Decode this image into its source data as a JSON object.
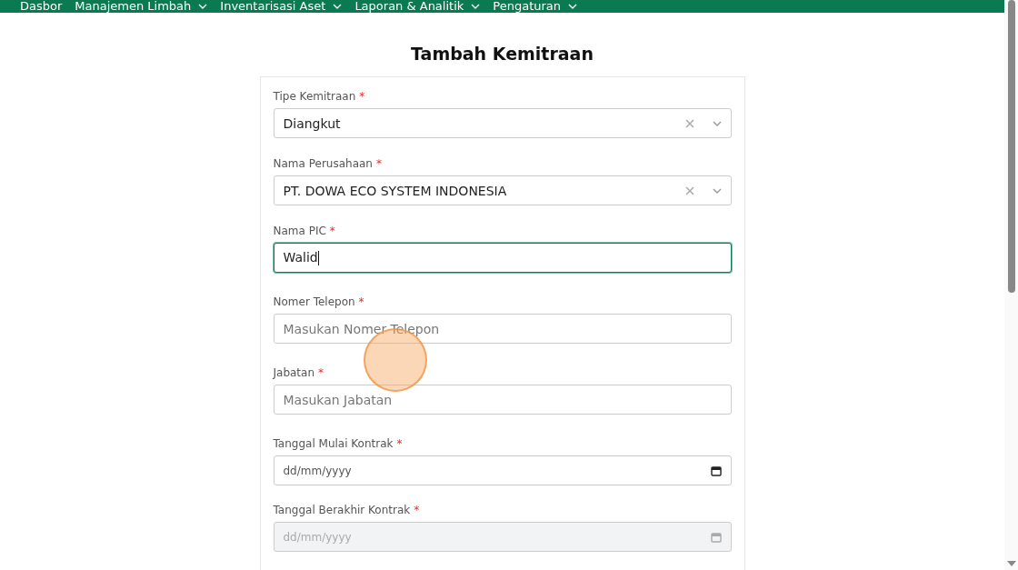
{
  "nav": {
    "items": [
      {
        "label": "Dasbor",
        "dropdown": false
      },
      {
        "label": "Manajemen Limbah",
        "dropdown": true
      },
      {
        "label": "Inventarisasi Aset",
        "dropdown": true
      },
      {
        "label": "Laporan & Analitik",
        "dropdown": true
      },
      {
        "label": "Pengaturan",
        "dropdown": true
      }
    ]
  },
  "page_title": "Tambah Kemitraan",
  "form": {
    "fields": [
      {
        "kind": "select",
        "label": "Tipe Kemitraan",
        "required": "*",
        "value": "Diangkut"
      },
      {
        "kind": "select",
        "label": "Nama Perusahaan",
        "required": "*",
        "value": "PT. DOWA ECO SYSTEM INDONESIA"
      },
      {
        "kind": "text",
        "label": "Nama PIC",
        "required": "*",
        "value": "Walid",
        "focused": true
      },
      {
        "kind": "text",
        "label": "Nomer Telepon",
        "required": "*",
        "placeholder": "Masukan Nomer Telepon",
        "focused": false
      },
      {
        "kind": "text",
        "label": "Jabatan",
        "required": "*",
        "placeholder": "Masukan Jabatan",
        "focused": false
      },
      {
        "kind": "date",
        "label": "Tanggal Mulai Kontrak",
        "required": "*",
        "placeholder": "dd/mm/yyyy",
        "disabled": false
      },
      {
        "kind": "date",
        "label": "Tanggal Berakhir Kontrak",
        "required": "*",
        "placeholder": "dd/mm/yyyy",
        "disabled": true
      }
    ]
  }
}
